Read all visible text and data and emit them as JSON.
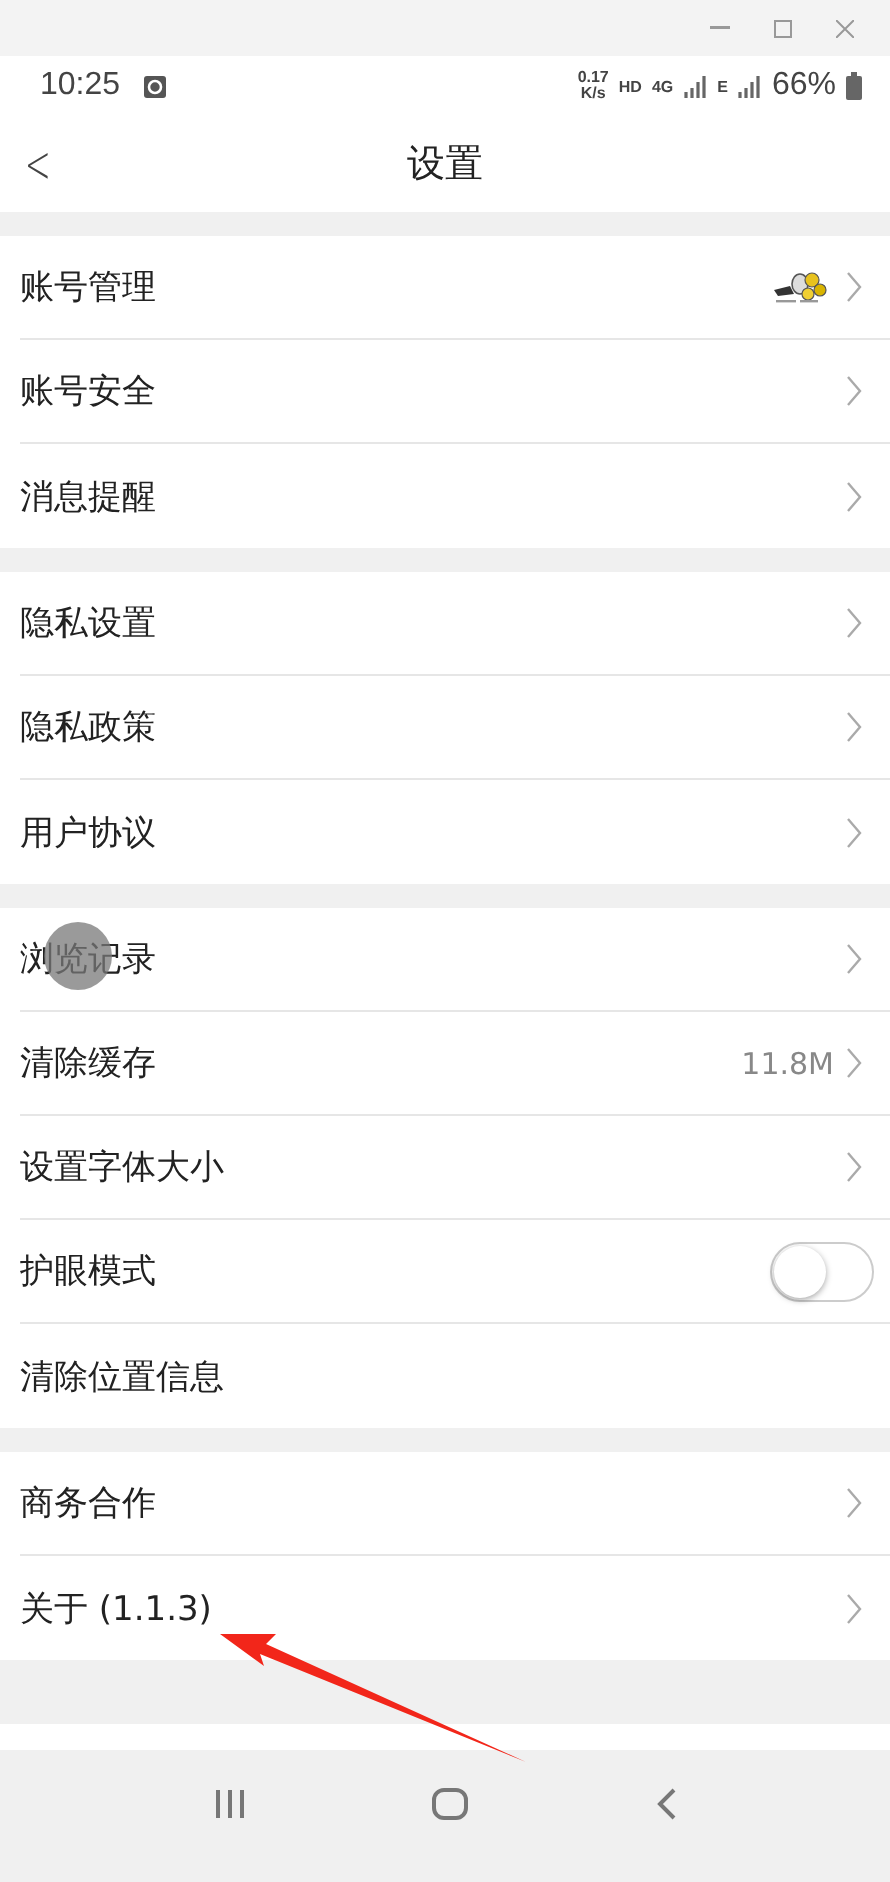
{
  "status_bar": {
    "time": "10:25",
    "speed": "0.17",
    "speed_unit": "K/s",
    "hd": "HD",
    "network": "4G",
    "network_2": "E",
    "battery": "66%"
  },
  "header": {
    "back": "<",
    "title": "设置"
  },
  "groups": [
    {
      "rows": [
        {
          "kind": "avatar",
          "label": "账号管理"
        },
        {
          "kind": "link",
          "label": "账号安全"
        },
        {
          "kind": "link",
          "label": "消息提醒"
        }
      ]
    },
    {
      "rows": [
        {
          "kind": "link",
          "label": "隐私设置"
        },
        {
          "kind": "link",
          "label": "隐私政策"
        },
        {
          "kind": "link",
          "label": "用户协议"
        }
      ]
    },
    {
      "rows": [
        {
          "kind": "link",
          "label": "浏览记录",
          "touched": true
        },
        {
          "kind": "value",
          "label": "清除缓存",
          "value": "11.8M"
        },
        {
          "kind": "link",
          "label": "设置字体大小"
        },
        {
          "kind": "toggle",
          "label": "护眼模式",
          "on": false
        },
        {
          "kind": "plain",
          "label": "清除位置信息"
        }
      ]
    },
    {
      "rows": [
        {
          "kind": "link",
          "label": "商务合作"
        },
        {
          "kind": "link",
          "label": "关于 (1.1.3)",
          "annotated": true
        }
      ]
    }
  ]
}
